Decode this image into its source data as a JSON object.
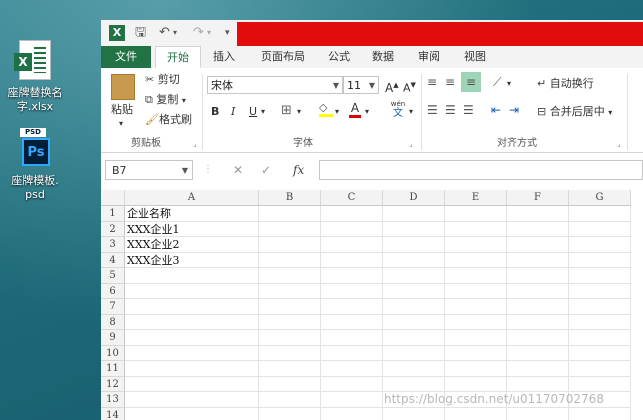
{
  "desktop": {
    "icons": [
      {
        "label_line1": "座牌替换名",
        "label_line2": "字.xlsx",
        "type": "excel"
      },
      {
        "label_line1": "座牌模板.",
        "label_line2": "psd",
        "type": "photoshop"
      }
    ]
  },
  "excel": {
    "quick_access": {
      "app_letter": "X",
      "save": "🖫",
      "undo": "↶",
      "redo": "↷"
    },
    "tabs": [
      "文件",
      "开始",
      "插入",
      "页面布局",
      "公式",
      "数据",
      "审阅",
      "视图"
    ],
    "active_tab": "开始",
    "clipboard": {
      "paste": "粘贴",
      "cut": "剪切",
      "copy": "复制",
      "format_painter": "格式刷",
      "group_label": "剪贴板"
    },
    "font": {
      "name": "宋体",
      "size": "11",
      "bold": "B",
      "italic": "I",
      "underline": "U",
      "color_letter": "A",
      "phonetic": "wén",
      "phonetic_sub": "文",
      "group_label": "字体"
    },
    "alignment": {
      "wrap_text": "自动换行",
      "merge_center": "合并后居中",
      "group_label": "对齐方式"
    },
    "name_box": "B7",
    "formula_buttons": {
      "cancel": "✕",
      "enter": "✓",
      "fx": "fx"
    },
    "columns": [
      "A",
      "B",
      "C",
      "D",
      "E",
      "F",
      "G"
    ],
    "rows": [
      "1",
      "2",
      "3",
      "4",
      "5",
      "6",
      "7",
      "8",
      "9",
      "10",
      "11",
      "12",
      "13",
      "14"
    ],
    "cells_A": [
      "企业名称",
      "XXX企业1",
      "XXX企业2",
      "XXX企业3"
    ]
  },
  "watermark": "https://blog.csdn.net/u011707027​68",
  "colors": {
    "excel_green": "#217346",
    "title_red": "#e10c0c"
  }
}
